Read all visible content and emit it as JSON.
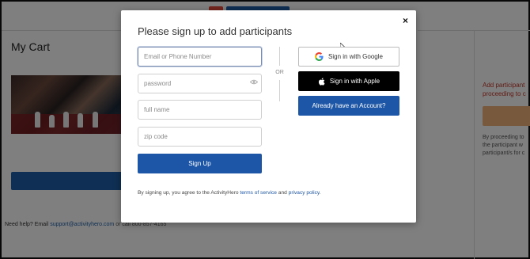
{
  "page": {
    "cart_title": "My Cart",
    "help_prefix": "Need help? Email",
    "help_email": "support@activityhero.com",
    "help_suffix": "or call 800-857-4165",
    "right_warning": [
      "Add participant",
      "proceeding to c"
    ],
    "right_note": [
      "By proceeding to",
      "the participant w",
      "participant/s for c"
    ]
  },
  "modal": {
    "title": "Please sign up to add participants",
    "close_symbol": "×",
    "fields": {
      "email_placeholder": "Email or Phone Number",
      "password_placeholder": "password",
      "fullname_placeholder": "full name",
      "zip_placeholder": "zip code"
    },
    "signup_label": "Sign Up",
    "or_label": "OR",
    "google_label": "Sign in with Google",
    "apple_label": "Sign in with Apple",
    "account_label": "Already have an Account?",
    "terms_prefix": "By signing up, you agree to the ActivityHero",
    "terms_link": "terms of service",
    "terms_and": "and",
    "privacy_link": "privacy policy",
    "terms_end": "."
  },
  "icons": {
    "google": "google-icon",
    "apple": "apple-icon",
    "eye": "eye-icon",
    "close": "close-icon"
  },
  "colors": {
    "primary": "#1d56a7",
    "apple_bg": "#000000",
    "warning": "#c0392b",
    "accent_button": "#f0b27a"
  }
}
